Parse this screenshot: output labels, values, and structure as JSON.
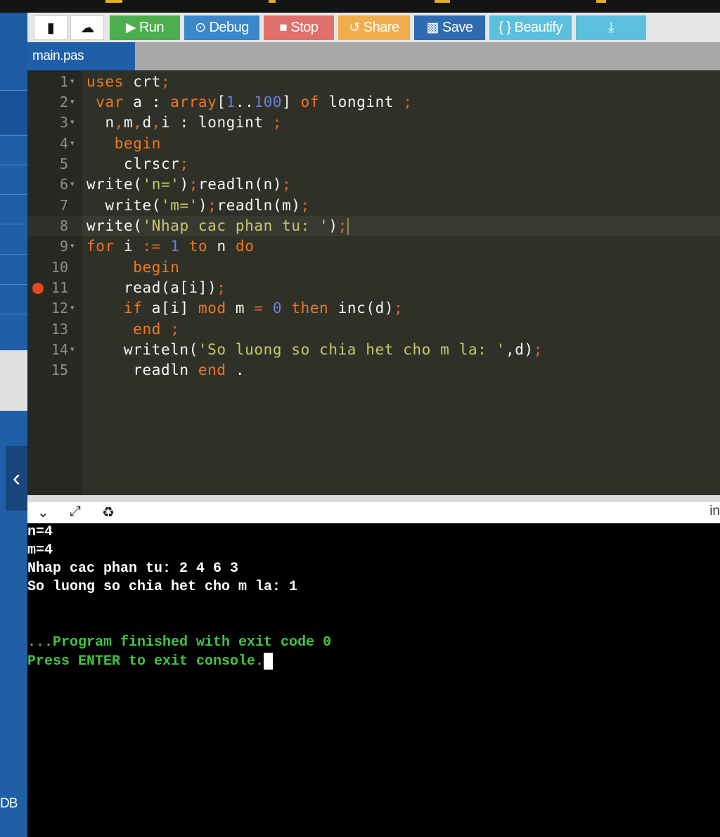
{
  "toolbar": {
    "buttons": [
      {
        "label": "",
        "icon": "new-file-icon",
        "color": "#ffffff"
      },
      {
        "label": "",
        "icon": "upload-icon",
        "color": "#ffffff"
      },
      {
        "label": "Run",
        "icon": "play-icon",
        "color": "#4cae4c"
      },
      {
        "label": "Debug",
        "icon": "debug-icon",
        "color": "#3a87c9"
      },
      {
        "label": "Stop",
        "icon": "stop-icon",
        "color": "#e0706c"
      },
      {
        "label": "Share",
        "icon": "share-icon",
        "color": "#f0ad4e"
      },
      {
        "label": "Save",
        "icon": "save-icon",
        "color": "#2f6bb0"
      },
      {
        "label": "{ } Beautify",
        "icon": "beautify-icon",
        "color": "#5bc0de"
      },
      {
        "label": "",
        "icon": "download-icon",
        "color": "#5bc0de"
      }
    ]
  },
  "editor": {
    "tab": "main.pas",
    "active_line": 8,
    "breakpoint_line": 11,
    "lines": [
      "uses crt;",
      " var a : array[1..100] of longint ;",
      "  n,m,d,i : longint ;",
      "   begin",
      "    clrscr;",
      "write('n=');readln(n);",
      "  write('m=');readln(m);",
      "write('Nhap cac phan tu: ');",
      "for i := 1 to n do",
      "     begin",
      "    read(a[i]);",
      "    if a[i] mod m = 0 then inc(d);",
      "     end ;",
      "    writeln('So luong so chia het cho m la: ',d);",
      "     readln end ."
    ]
  },
  "console": {
    "input_label": "in",
    "output": [
      "n=4",
      "m=4",
      "Nhap cac phan tu: 2 4 6 3",
      "So luong so chia het cho m la: 1",
      "",
      "",
      "...Program finished with exit code 0",
      "Press ENTER to exit console."
    ]
  },
  "sidebar": {
    "bottom_label": "DB"
  }
}
